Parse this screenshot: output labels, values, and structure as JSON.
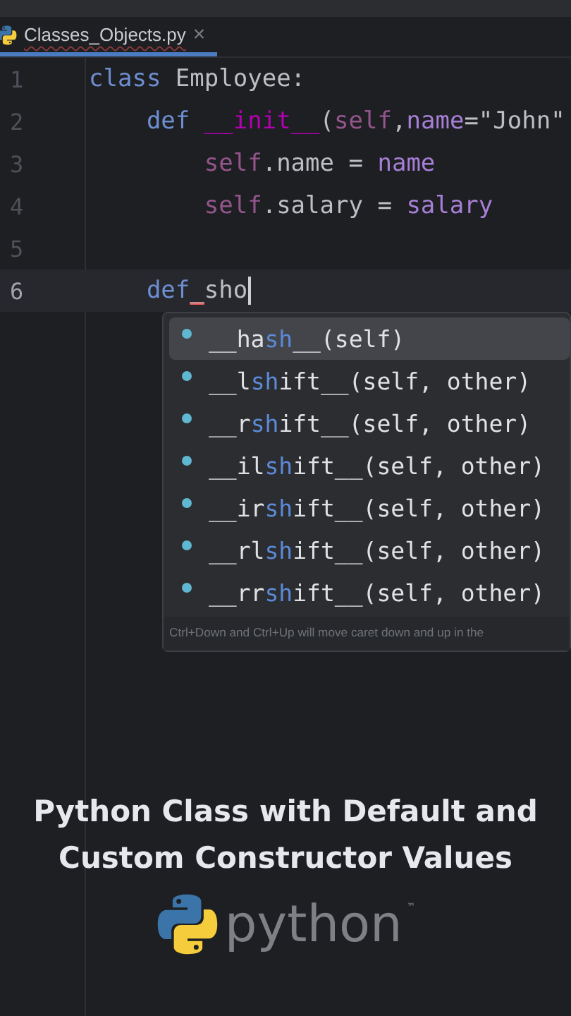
{
  "tab": {
    "filename": "Classes_Objects.py",
    "close": "×",
    "selected": true
  },
  "lines": [
    {
      "number": "1",
      "current": false,
      "caret": false,
      "tokens": [
        {
          "text": "class ",
          "kind": "keyword"
        },
        {
          "text": "Employee:",
          "kind": "plain"
        }
      ]
    },
    {
      "number": "2",
      "current": false,
      "caret": false,
      "tokens": [
        {
          "text": "    def ",
          "kind": "keyword"
        },
        {
          "text": "__init__",
          "kind": "dunder"
        },
        {
          "text": "(",
          "kind": "plain"
        },
        {
          "text": "self",
          "kind": "self"
        },
        {
          "text": ",",
          "kind": "plain"
        },
        {
          "text": "name",
          "kind": "param"
        },
        {
          "text": "=\"John\"",
          "kind": "plain"
        }
      ]
    },
    {
      "number": "3",
      "current": false,
      "caret": false,
      "tokens": [
        {
          "text": "        self",
          "kind": "self"
        },
        {
          "text": ".name = ",
          "kind": "plain"
        },
        {
          "text": "name",
          "kind": "param"
        }
      ]
    },
    {
      "number": "4",
      "current": false,
      "caret": false,
      "tokens": [
        {
          "text": "        self",
          "kind": "self"
        },
        {
          "text": ".salary = ",
          "kind": "plain"
        },
        {
          "text": "salary",
          "kind": "param"
        }
      ]
    },
    {
      "number": "5",
      "current": false,
      "caret": false
    },
    {
      "number": "6",
      "current": true,
      "caret": true,
      "tokens": [
        {
          "text": "    def",
          "kind": "keyword"
        },
        {
          "text": "_",
          "kind": "error"
        },
        {
          "text": "sho",
          "kind": "plain"
        }
      ]
    }
  ],
  "completions": [
    {
      "selected": true,
      "parts": [
        {
          "text": "__ha",
          "match": false
        },
        {
          "text": "sh",
          "match": true
        },
        {
          "text": "__(self)",
          "match": false
        }
      ]
    },
    {
      "selected": false,
      "parts": [
        {
          "text": "__l",
          "match": false
        },
        {
          "text": "sh",
          "match": true
        },
        {
          "text": "ift__(self, other)",
          "match": false
        }
      ]
    },
    {
      "selected": false,
      "parts": [
        {
          "text": "__r",
          "match": false
        },
        {
          "text": "sh",
          "match": true
        },
        {
          "text": "ift__(self, other)",
          "match": false
        }
      ]
    },
    {
      "selected": false,
      "parts": [
        {
          "text": "__il",
          "match": false
        },
        {
          "text": "sh",
          "match": true
        },
        {
          "text": "ift__(self, other)",
          "match": false
        }
      ]
    },
    {
      "selected": false,
      "parts": [
        {
          "text": "__ir",
          "match": false
        },
        {
          "text": "sh",
          "match": true
        },
        {
          "text": "ift__(self, other)",
          "match": false
        }
      ]
    },
    {
      "selected": false,
      "parts": [
        {
          "text": "__rl",
          "match": false
        },
        {
          "text": "sh",
          "match": true
        },
        {
          "text": "ift__(self, other)",
          "match": false
        }
      ]
    },
    {
      "selected": false,
      "parts": [
        {
          "text": "__rr",
          "match": false
        },
        {
          "text": "sh",
          "match": true
        },
        {
          "text": "ift__(self, other)",
          "match": false
        }
      ]
    }
  ],
  "completion_hint": "Ctrl+Down and Ctrl+Up will move caret down and up in the",
  "caption": {
    "title": "Python Class with Default and Custom Constructor Values",
    "logo_text": "python",
    "trademark": "™"
  }
}
